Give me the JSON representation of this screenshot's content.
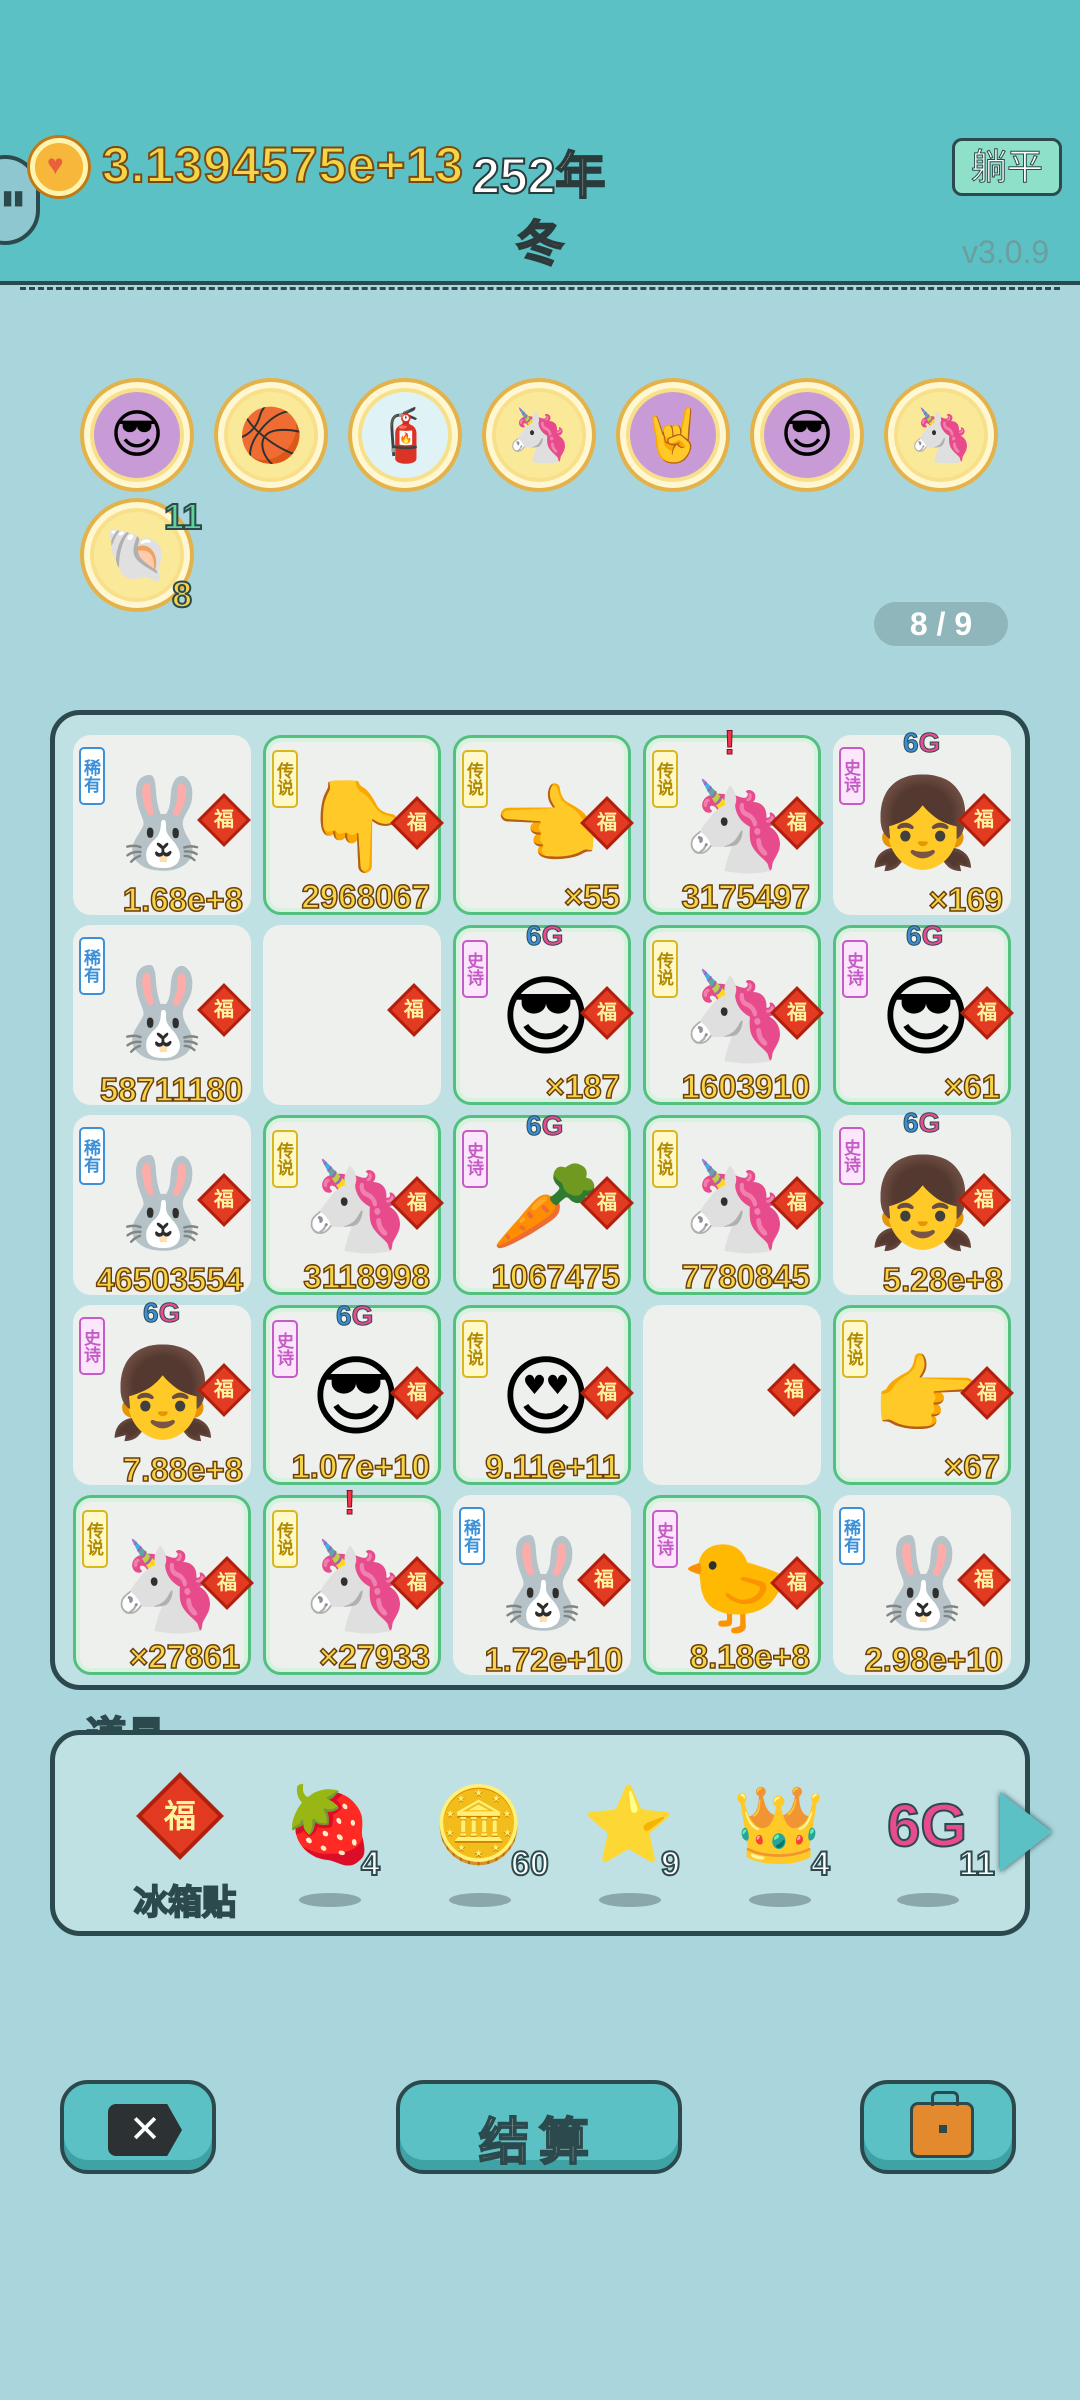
{
  "header": {
    "money": "3.1394575e+13",
    "year": "252年",
    "season": "冬",
    "flat_button": "躺平",
    "version": "v3.0.9"
  },
  "badges": [
    {
      "icon": "math-guy-icon",
      "glyph": "😎"
    },
    {
      "icon": "basketballs-icon",
      "glyph": "🏀"
    },
    {
      "icon": "pump-icon",
      "glyph": "🧯"
    },
    {
      "icon": "unicorn-icon",
      "glyph": "🦄"
    },
    {
      "icon": "rock-hand-icon",
      "glyph": "🤘"
    },
    {
      "icon": "math-guy-icon",
      "glyph": "😎"
    },
    {
      "icon": "unicorn-icon",
      "glyph": "🦄"
    },
    {
      "icon": "shell-icon",
      "glyph": "🐚",
      "top": "11",
      "bottom": "8"
    }
  ],
  "pager": "8 / 9",
  "rarity_labels": {
    "common": "稀有",
    "legend": "传说",
    "epic": "史诗"
  },
  "fu": "福",
  "cells": [
    {
      "rarity": "common",
      "pic": "rabbit-icon",
      "glyph": "🐰",
      "value": "1.68e+8",
      "green": false
    },
    {
      "rarity": "legend",
      "pic": "pointing-hand-icon",
      "glyph": "👇",
      "value": "2968067",
      "green": true
    },
    {
      "rarity": "legend",
      "pic": "pointing-hand-icon",
      "glyph": "👈",
      "value": "×55",
      "green": true
    },
    {
      "rarity": "legend",
      "pic": "unicorn-icon",
      "glyph": "🦄",
      "value": "3175497",
      "green": true,
      "alert": "!"
    },
    {
      "rarity": "epic",
      "pic": "girl-icon",
      "glyph": "👧",
      "value": "×169",
      "green": false,
      "g6": true
    },
    {
      "rarity": "common",
      "pic": "rabbit-icon",
      "glyph": "🐰",
      "value": "58711180",
      "green": false
    },
    {
      "rarity": "",
      "pic": "",
      "glyph": "",
      "value": "",
      "green": false
    },
    {
      "rarity": "epic",
      "pic": "cool-guy-icon",
      "glyph": "😎",
      "value": "×187",
      "green": true,
      "g6": true
    },
    {
      "rarity": "legend",
      "pic": "unicorn-icon",
      "glyph": "🦄",
      "value": "1603910",
      "green": true
    },
    {
      "rarity": "epic",
      "pic": "cool-guy-icon",
      "glyph": "😎",
      "value": "×61",
      "green": true,
      "g6": true
    },
    {
      "rarity": "common",
      "pic": "rabbit-icon",
      "glyph": "🐰",
      "value": "46503554",
      "green": false
    },
    {
      "rarity": "legend",
      "pic": "unicorn-icon",
      "glyph": "🦄",
      "value": "3118998",
      "green": true
    },
    {
      "rarity": "epic",
      "pic": "carrot-icon",
      "glyph": "🥕",
      "value": "1067475",
      "green": true,
      "g6": true
    },
    {
      "rarity": "legend",
      "pic": "unicorn-icon",
      "glyph": "🦄",
      "value": "7780845",
      "green": true
    },
    {
      "rarity": "epic",
      "pic": "girl-icon",
      "glyph": "👧",
      "value": "5.28e+8",
      "green": false,
      "g6": true
    },
    {
      "rarity": "epic",
      "pic": "girl-icon",
      "glyph": "👧",
      "value": "7.88e+8",
      "green": false,
      "g6": true
    },
    {
      "rarity": "epic",
      "pic": "cool-guy-icon",
      "glyph": "😎",
      "value": "1.07e+10",
      "green": true,
      "g6": true
    },
    {
      "rarity": "legend",
      "pic": "bald-guy-icon",
      "glyph": "😍",
      "value": "9.11e+11",
      "green": true
    },
    {
      "rarity": "",
      "pic": "",
      "glyph": "",
      "value": "",
      "green": false
    },
    {
      "rarity": "legend",
      "pic": "pointing-hand-icon",
      "glyph": "👉",
      "value": "×67",
      "green": true
    },
    {
      "rarity": "legend",
      "pic": "unicorn-icon",
      "glyph": "🦄",
      "value": "×27861",
      "green": true
    },
    {
      "rarity": "legend",
      "pic": "unicorn-icon",
      "glyph": "🦄",
      "value": "×27933",
      "green": true,
      "alert": "!"
    },
    {
      "rarity": "common",
      "pic": "rabbit-icon",
      "glyph": "🐰",
      "value": "1.72e+10",
      "green": false
    },
    {
      "rarity": "epic",
      "pic": "chick-icon",
      "glyph": "🐤",
      "value": "8.18e+8",
      "green": true
    },
    {
      "rarity": "common",
      "pic": "rabbit-icon",
      "glyph": "🐰",
      "value": "2.98e+10",
      "green": false
    }
  ],
  "g6": {
    "a": "6",
    "b": "G"
  },
  "items_title": "道具",
  "items": [
    {
      "icon": "fridge-sticker-icon",
      "label": "冰箱贴",
      "count": ""
    },
    {
      "icon": "lychee-icon",
      "glyph": "🍓",
      "count": "4"
    },
    {
      "icon": "coin-icon",
      "glyph": "🪙",
      "count": "60"
    },
    {
      "icon": "star-icon",
      "glyph": "⭐",
      "count": "9"
    },
    {
      "icon": "crown-icon",
      "glyph": "👑",
      "count": "4"
    },
    {
      "icon": "6g-icon",
      "glyph": "6G",
      "count": "11"
    }
  ],
  "buttons": {
    "settle": "结算"
  }
}
